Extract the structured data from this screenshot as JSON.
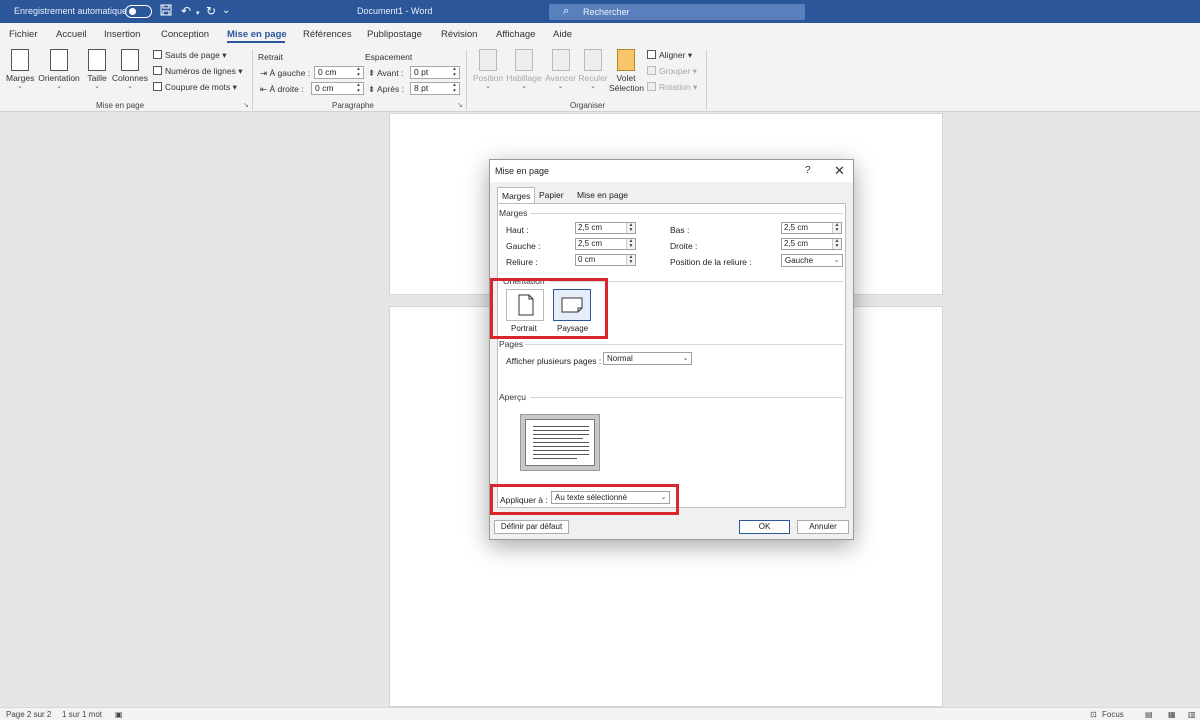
{
  "titlebar": {
    "autosave_label": "Enregistrement automatique",
    "document_title": "Document1 - Word",
    "search_placeholder": "Rechercher"
  },
  "ribbon_tabs": [
    "Fichier",
    "Accueil",
    "Insertion",
    "Conception",
    "Mise en page",
    "Références",
    "Publipostage",
    "Révision",
    "Affichage",
    "Aide"
  ],
  "active_tab": "Mise en page",
  "ribbon": {
    "mise_en_page": {
      "label": "Mise en page",
      "buttons": [
        "Marges",
        "Orientation",
        "Taille",
        "Colonnes"
      ],
      "small_buttons": [
        "Sauts de page",
        "Numéros de lignes",
        "Coupure de mots"
      ]
    },
    "paragraphe": {
      "label": "Paragraphe",
      "retrait_label": "Retrait",
      "espacement_label": "Espacement",
      "gauche_label": "À gauche :",
      "gauche_value": "0 cm",
      "droite_label": "À droite :",
      "droite_value": "0 cm",
      "avant_label": "Avant :",
      "avant_value": "0 pt",
      "apres_label": "Après :",
      "apres_value": "8 pt"
    },
    "organiser": {
      "label": "Organiser",
      "buttons": [
        "Position",
        "Habillage",
        "Avancer",
        "Reculer"
      ],
      "volet_line1": "Volet",
      "volet_line2": "Sélection",
      "small_buttons": [
        "Aligner",
        "Grouper",
        "Rotation"
      ]
    }
  },
  "dialog": {
    "title": "Mise en page",
    "help": "?",
    "close": "✕",
    "tabs": [
      "Marges",
      "Papier",
      "Mise en page"
    ],
    "active_tab": "Marges",
    "marges": {
      "section_title": "Marges",
      "haut_label": "Haut :",
      "haut_value": "2,5 cm",
      "bas_label": "Bas :",
      "bas_value": "2,5 cm",
      "gauche_label": "Gauche :",
      "gauche_value": "2,5 cm",
      "droite_label": "Droite :",
      "droite_value": "2,5 cm",
      "reliure_label": "Reliure :",
      "reliure_value": "0 cm",
      "position_reliure_label": "Position de la reliure :",
      "position_reliure_value": "Gauche"
    },
    "orientation": {
      "section_title": "Orientation",
      "portrait_label": "Portrait",
      "paysage_label": "Paysage",
      "selected": "Paysage"
    },
    "pages": {
      "section_title": "Pages",
      "plusieurs_label": "Afficher plusieurs pages :",
      "plusieurs_value": "Normal"
    },
    "apercu": {
      "section_title": "Aperçu"
    },
    "appliquer": {
      "label": "Appliquer à :",
      "value": "Au texte sélectionné"
    },
    "buttons": {
      "default": "Définir par défaut",
      "ok": "OK",
      "cancel": "Annuler"
    }
  },
  "statusbar": {
    "page": "Page 2 sur 2",
    "words": "1 sur 1 mot",
    "focus": "Focus"
  },
  "colors": {
    "accent": "#2b579a",
    "highlight": "#d9262c"
  }
}
